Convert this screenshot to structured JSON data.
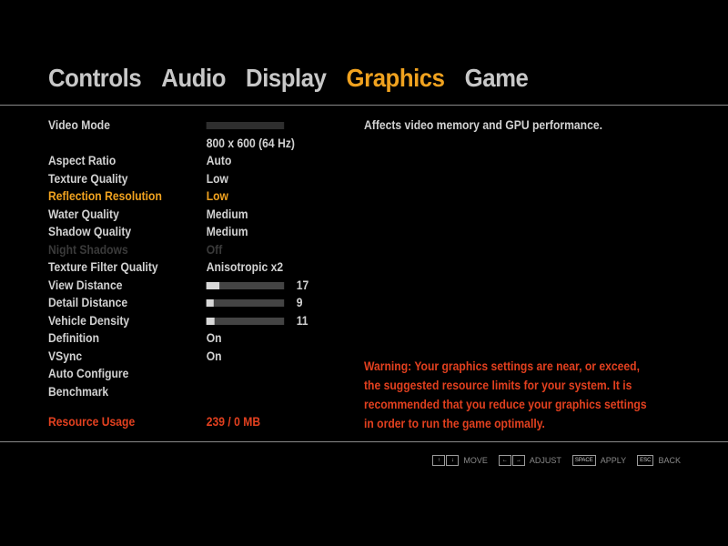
{
  "tabs": [
    {
      "label": "Controls"
    },
    {
      "label": "Audio"
    },
    {
      "label": "Display"
    },
    {
      "label": "Graphics"
    },
    {
      "label": "Game"
    }
  ],
  "active_tab": "Graphics",
  "settings": {
    "video_mode": {
      "label": "Video Mode",
      "value": "800 x 600 (64 Hz)"
    },
    "aspect_ratio": {
      "label": "Aspect Ratio",
      "value": "Auto"
    },
    "texture_quality": {
      "label": "Texture Quality",
      "value": "Low"
    },
    "reflection_resolution": {
      "label": "Reflection Resolution",
      "value": "Low"
    },
    "water_quality": {
      "label": "Water Quality",
      "value": "Medium"
    },
    "shadow_quality": {
      "label": "Shadow Quality",
      "value": "Medium"
    },
    "night_shadows": {
      "label": "Night Shadows",
      "value": "Off"
    },
    "texture_filter_quality": {
      "label": "Texture Filter Quality",
      "value": "Anisotropic x2"
    },
    "view_distance": {
      "label": "View Distance",
      "value": "17",
      "level": 0.17
    },
    "detail_distance": {
      "label": "Detail Distance",
      "value": "9",
      "level": 0.09
    },
    "vehicle_density": {
      "label": "Vehicle Density",
      "value": "11",
      "level": 0.11
    },
    "definition": {
      "label": "Definition",
      "value": "On"
    },
    "vsync": {
      "label": "VSync",
      "value": "On"
    },
    "auto_configure": {
      "label": "Auto Configure"
    },
    "benchmark": {
      "label": "Benchmark"
    },
    "resource_usage": {
      "label": "Resource Usage",
      "value": "239 / 0 MB"
    }
  },
  "description": "Affects video memory and GPU performance.",
  "warning": "Warning: Your graphics settings are near, or exceed, the suggested resource limits for your system. It is recommended that you reduce your graphics settings in order to run the game optimally.",
  "hints": [
    {
      "keys": [
        "↑",
        "↓"
      ],
      "label": "MOVE"
    },
    {
      "keys": [
        "←",
        "→"
      ],
      "label": "ADJUST"
    },
    {
      "keys": [
        "SPACE"
      ],
      "label": "APPLY"
    },
    {
      "keys": [
        "ESC"
      ],
      "label": "BACK"
    }
  ],
  "colors": {
    "accent": "#f0a21f",
    "warning": "#e2401f",
    "text": "#d2d2d2",
    "disabled": "#3a3a3a",
    "background": "#000000"
  }
}
